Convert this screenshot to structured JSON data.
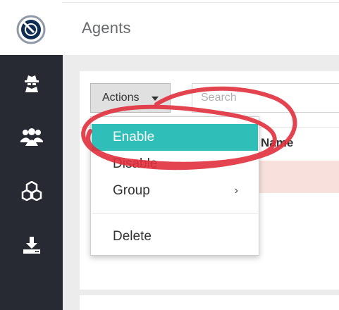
{
  "header": {
    "title": "Agents",
    "logo": "logo-icon"
  },
  "sidebar": {
    "items": [
      {
        "icon": "spy-icon"
      },
      {
        "icon": "users-icon"
      },
      {
        "icon": "cubes-icon"
      },
      {
        "icon": "download-icon"
      }
    ]
  },
  "toolbar": {
    "actions_label": "Actions",
    "search_placeholder": "Search"
  },
  "table": {
    "columns": [
      "Name"
    ]
  },
  "dropdown": {
    "items": [
      {
        "label": "Enable",
        "active": true
      },
      {
        "label": "Disable"
      },
      {
        "label": "Group",
        "has_submenu": true,
        "chevron": "›"
      },
      {
        "label": "Delete"
      }
    ]
  },
  "colors": {
    "accent": "#2fbfb8",
    "sidebar": "#272a33",
    "annotation": "#e0303c",
    "row_highlight": "#f8e0dc"
  }
}
